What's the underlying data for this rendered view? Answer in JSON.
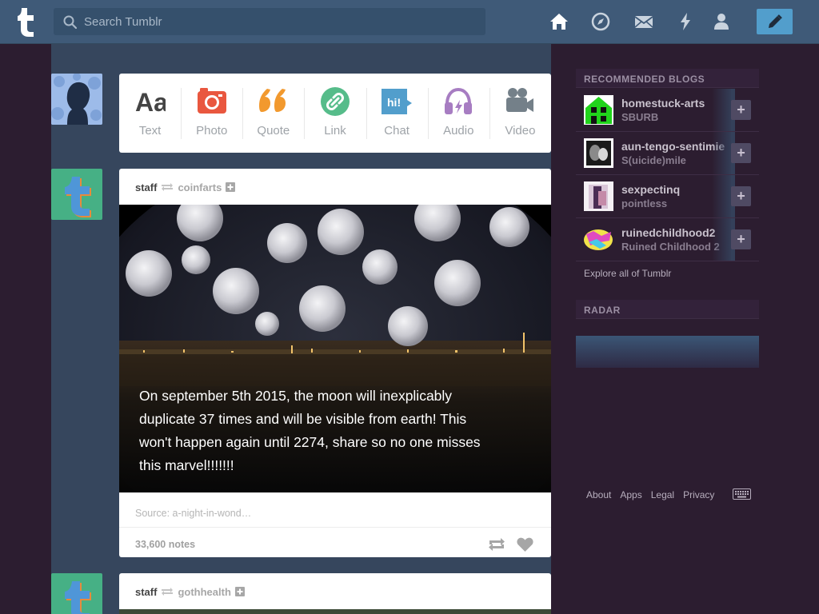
{
  "header": {
    "search_placeholder": "Search Tumblr",
    "nav": [
      "home-icon",
      "explore-compass-icon",
      "inbox-mail-icon",
      "activity-lightning-icon",
      "account-person-icon"
    ],
    "compose_icon": "pencil-icon"
  },
  "post_types": [
    {
      "label": "Text",
      "icon": "text-aa-icon"
    },
    {
      "label": "Photo",
      "icon": "camera-icon"
    },
    {
      "label": "Quote",
      "icon": "quote-icon"
    },
    {
      "label": "Link",
      "icon": "link-icon"
    },
    {
      "label": "Chat",
      "icon": "chat-bubble-icon",
      "glyph": "hi!"
    },
    {
      "label": "Audio",
      "icon": "headphones-icon"
    },
    {
      "label": "Video",
      "icon": "video-camera-icon"
    }
  ],
  "posts": [
    {
      "author": "staff",
      "reblogged_from": "coinfarts",
      "caption": "On september 5th 2015, the moon will inexplicably duplicate 37 times and will be visible from earth! This won't happen again until 2274, share so no one misses this marvel!!!!!!!",
      "source": "Source: a-night-in-wond…",
      "notes": "33,600 notes"
    },
    {
      "author": "staff",
      "reblogged_from": "gothhealth"
    }
  ],
  "sidebar": {
    "recommended_heading": "RECOMMENDED BLOGS",
    "recommended": [
      {
        "name": "homestuck-arts",
        "title": "SBURB"
      },
      {
        "name": "aun-tengo-sentimie",
        "title": "S(uicide)mile"
      },
      {
        "name": "sexpectinq",
        "title": "pointless"
      },
      {
        "name": "ruinedchildhood2",
        "title": "Ruined Childhood 2"
      }
    ],
    "follow_symbol": "+",
    "explore_link": "Explore all of Tumblr",
    "radar_heading": "RADAR"
  },
  "footer": {
    "links": [
      "About",
      "Apps",
      "Legal",
      "Privacy"
    ]
  },
  "colors": {
    "header": "#3f5a78",
    "page_background": "#2c1d30",
    "dashboard_rail": "#36465d",
    "compose_button": "#529ecc",
    "photo_accent": "#e9573f",
    "quote_accent": "#f2992e",
    "link_accent": "#56bc8a",
    "chat_accent": "#529ecc",
    "audio_accent": "#a77dc2",
    "video_accent": "#748089"
  }
}
